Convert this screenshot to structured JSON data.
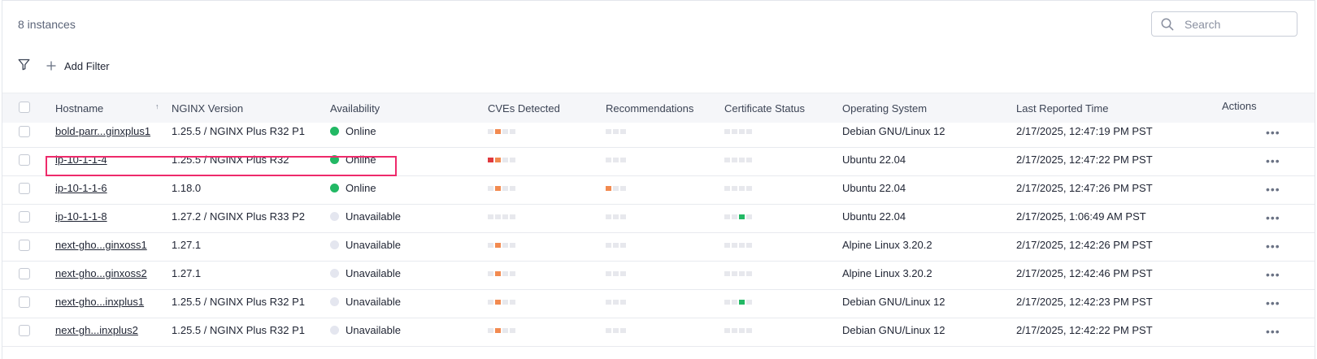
{
  "toolbar": {
    "instance_count": "8 instances",
    "search_placeholder": "Search",
    "add_filter_label": "Add Filter"
  },
  "table": {
    "headers": {
      "hostname": "Hostname",
      "nginx_version": "NGINX Version",
      "availability": "Availability",
      "cves": "CVEs Detected",
      "recommendations": "Recommendations",
      "cert_status": "Certificate Status",
      "os": "Operating System",
      "last_reported": "Last Reported Time",
      "actions": "Actions"
    },
    "sort_indicator": "↑",
    "action_glyph": "•••",
    "rows": [
      {
        "hostname": "bold-parr...ginxplus1",
        "version": "1.25.5 / NGINX Plus R32 P1",
        "availability": "Online",
        "cves": [
          "gray",
          "orange",
          "gray",
          "gray"
        ],
        "recs": [
          "gray",
          "gray",
          "gray"
        ],
        "certs": [
          "gray",
          "gray",
          "gray",
          "gray"
        ],
        "os": "Debian GNU/Linux 12",
        "last": "2/17/2025, 12:47:19 PM PST"
      },
      {
        "hostname": "ip-10-1-1-4",
        "version": "1.25.5 / NGINX Plus R32",
        "availability": "Online",
        "cves": [
          "red",
          "orange",
          "gray",
          "gray"
        ],
        "recs": [
          "gray",
          "gray",
          "gray"
        ],
        "certs": [
          "gray",
          "gray",
          "gray",
          "gray"
        ],
        "os": "Ubuntu 22.04",
        "last": "2/17/2025, 12:47:22 PM PST"
      },
      {
        "hostname": "ip-10-1-1-6",
        "version": "1.18.0",
        "availability": "Online",
        "cves": [
          "gray",
          "orange",
          "gray",
          "gray"
        ],
        "recs": [
          "orange",
          "gray",
          "gray"
        ],
        "certs": [
          "gray",
          "gray",
          "gray",
          "gray"
        ],
        "os": "Ubuntu 22.04",
        "last": "2/17/2025, 12:47:26 PM PST"
      },
      {
        "hostname": "ip-10-1-1-8",
        "version": "1.27.2 / NGINX Plus R33 P2",
        "availability": "Unavailable",
        "cves": [
          "gray",
          "gray",
          "gray",
          "gray"
        ],
        "recs": [
          "gray",
          "gray",
          "gray"
        ],
        "certs": [
          "gray",
          "gray",
          "green",
          "gray"
        ],
        "os": "Ubuntu 22.04",
        "last": "2/17/2025, 1:06:49 AM PST"
      },
      {
        "hostname": "next-gho...ginxoss1",
        "version": "1.27.1",
        "availability": "Unavailable",
        "cves": [
          "gray",
          "orange",
          "gray",
          "gray"
        ],
        "recs": [
          "gray",
          "gray",
          "gray"
        ],
        "certs": [
          "gray",
          "gray",
          "gray",
          "gray"
        ],
        "os": "Alpine Linux 3.20.2",
        "last": "2/17/2025, 12:42:26 PM PST"
      },
      {
        "hostname": "next-gho...ginxoss2",
        "version": "1.27.1",
        "availability": "Unavailable",
        "cves": [
          "gray",
          "orange",
          "gray",
          "gray"
        ],
        "recs": [
          "gray",
          "gray",
          "gray"
        ],
        "certs": [
          "gray",
          "gray",
          "gray",
          "gray"
        ],
        "os": "Alpine Linux 3.20.2",
        "last": "2/17/2025, 12:42:46 PM PST"
      },
      {
        "hostname": "next-gho...inxplus1",
        "version": "1.25.5 / NGINX Plus R32 P1",
        "availability": "Unavailable",
        "cves": [
          "gray",
          "orange",
          "gray",
          "gray"
        ],
        "recs": [
          "gray",
          "gray",
          "gray"
        ],
        "certs": [
          "gray",
          "gray",
          "green",
          "gray"
        ],
        "os": "Debian GNU/Linux 12",
        "last": "2/17/2025, 12:42:23 PM PST"
      },
      {
        "hostname": "next-gh...inxplus2",
        "version": "1.25.5 / NGINX Plus R32 P1",
        "availability": "Unavailable",
        "cves": [
          "gray",
          "orange",
          "gray",
          "gray"
        ],
        "recs": [
          "gray",
          "gray",
          "gray"
        ],
        "certs": [
          "gray",
          "gray",
          "gray",
          "gray"
        ],
        "os": "Debian GNU/Linux 12",
        "last": "2/17/2025, 12:42:22 PM PST"
      }
    ]
  },
  "colors": {
    "online": "#22b864",
    "unavailable": "#e4e6ef",
    "cve_red": "#e0393e",
    "cve_orange": "#f28a50",
    "highlight": "#ee2a6b"
  },
  "icons": [
    "search-icon",
    "filter-icon",
    "plus-icon",
    "sort-ascending-icon",
    "more-actions-icon"
  ]
}
